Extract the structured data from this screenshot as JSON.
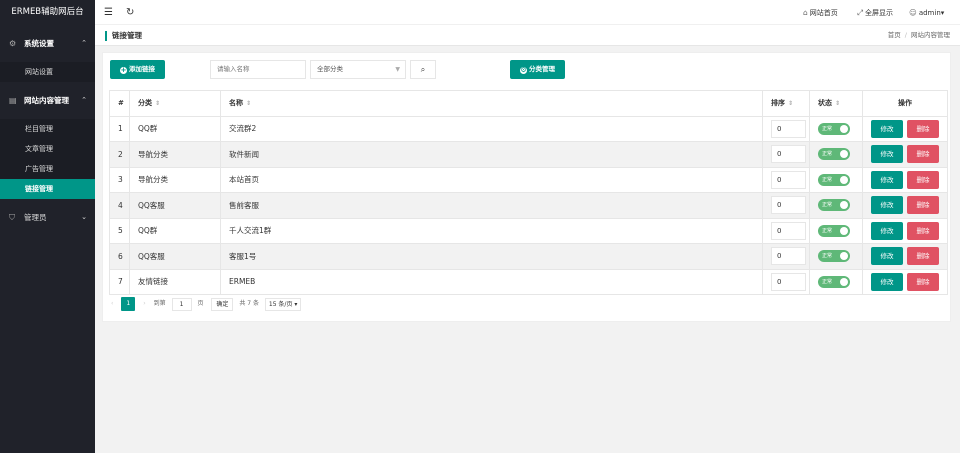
{
  "app": {
    "title": "ERMEB辅助网后台"
  },
  "sidebar": {
    "groups": [
      {
        "label": "系统设置",
        "icon": "gear-icon",
        "items": [
          {
            "label": "网站设置"
          }
        ]
      },
      {
        "label": "网站内容管理",
        "icon": "document-icon",
        "items": [
          {
            "label": "栏目管理"
          },
          {
            "label": "文章管理"
          },
          {
            "label": "广告管理"
          },
          {
            "label": "链接管理"
          }
        ]
      },
      {
        "label": "管理员",
        "icon": "shield-icon",
        "items": []
      }
    ]
  },
  "topbar": {
    "site_home": "网站首页",
    "fullscreen": "全屏显示",
    "user": "admin"
  },
  "page": {
    "title": "链接管理",
    "breadcrumb": [
      "首页",
      "网站内容管理"
    ]
  },
  "toolbar": {
    "add_label": "添加链接",
    "name_placeholder": "请输入名称",
    "category_select": "全部分类",
    "category_manage": "分类管理"
  },
  "table": {
    "headers": [
      "#",
      "分类",
      "名称",
      "排序",
      "状态",
      "操作"
    ],
    "status_label": "正常",
    "edit_label": "修改",
    "delete_label": "删除",
    "rows": [
      {
        "id": "1",
        "category": "QQ群",
        "name": "交流群2",
        "order": "0"
      },
      {
        "id": "2",
        "category": "导航分类",
        "name": "软件新闻",
        "order": "0"
      },
      {
        "id": "3",
        "category": "导航分类",
        "name": "本站首页",
        "order": "0"
      },
      {
        "id": "4",
        "category": "QQ客服",
        "name": "售前客服",
        "order": "0"
      },
      {
        "id": "5",
        "category": "QQ群",
        "name": "千人交流1群",
        "order": "0"
      },
      {
        "id": "6",
        "category": "QQ客服",
        "name": "客服1号",
        "order": "0"
      },
      {
        "id": "7",
        "category": "友情链接",
        "name": "ERMEB",
        "order": "0"
      }
    ]
  },
  "pagination": {
    "current": "1",
    "goto_prefix": "到第",
    "goto_value": "1",
    "goto_suffix": "页",
    "confirm": "确定",
    "total": "共 7 条",
    "page_size": "15 条/页"
  },
  "colors": {
    "accent": "#009688",
    "danger": "#e05263",
    "sidebar": "#20222a",
    "switch_on": "#5FB878"
  }
}
